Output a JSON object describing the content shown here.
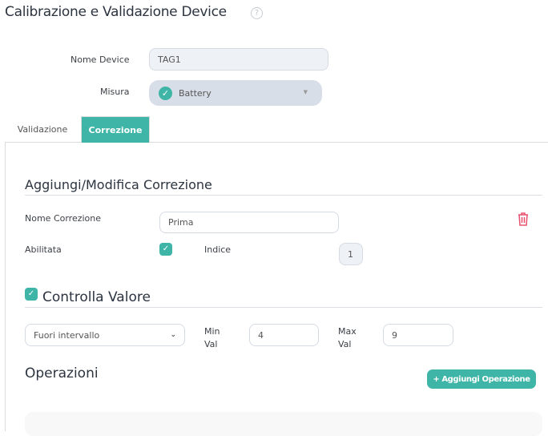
{
  "header": {
    "title": "Calibrazione e Validazione Device",
    "help_icon": "?"
  },
  "device": {
    "name_label": "Nome Device",
    "name_value": "TAG1",
    "measure_label": "Misura",
    "measure_value": "Battery"
  },
  "tabs": [
    {
      "label": "Validazione",
      "active": false
    },
    {
      "label": "Correzione",
      "active": true
    }
  ],
  "correction": {
    "section_title": "Aggiungi/Modifica Correzione",
    "name_label": "Nome Correzione",
    "name_value": "Prima",
    "enabled_label": "Abilitata",
    "enabled": true,
    "index_label": "Indice",
    "index_value": "1"
  },
  "check_value": {
    "title": "Controlla Valore",
    "checked": true,
    "mode": "Fuori intervallo",
    "min_label_1": "Min",
    "min_label_2": "Val",
    "min_value": "4",
    "max_label_1": "Max",
    "max_label_2": "Val",
    "max_value": "9"
  },
  "operations": {
    "title": "Operazioni",
    "add_button": "Aggiungi Operazione"
  },
  "colors": {
    "accent": "#3fb5a7",
    "danger": "#e8506e"
  }
}
